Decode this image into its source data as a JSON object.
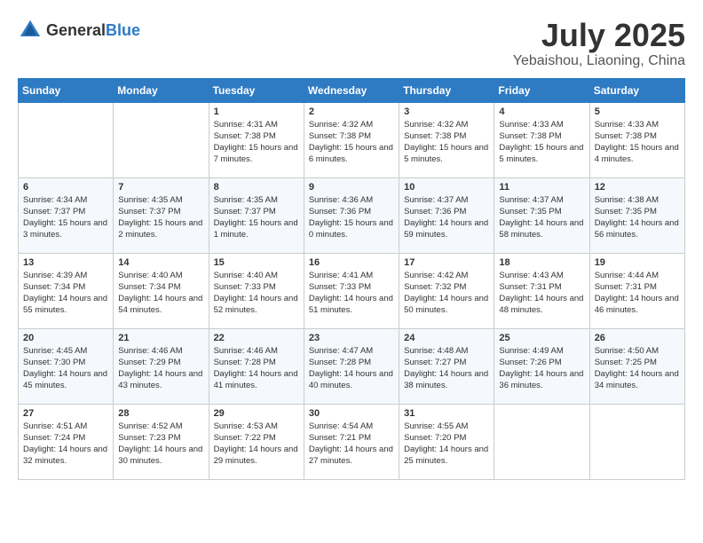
{
  "header": {
    "logo_general": "General",
    "logo_blue": "Blue",
    "month": "July 2025",
    "location": "Yebaishou, Liaoning, China"
  },
  "weekdays": [
    "Sunday",
    "Monday",
    "Tuesday",
    "Wednesday",
    "Thursday",
    "Friday",
    "Saturday"
  ],
  "weeks": [
    [
      {
        "day": "",
        "info": ""
      },
      {
        "day": "",
        "info": ""
      },
      {
        "day": "1",
        "info": "Sunrise: 4:31 AM\nSunset: 7:38 PM\nDaylight: 15 hours and 7 minutes."
      },
      {
        "day": "2",
        "info": "Sunrise: 4:32 AM\nSunset: 7:38 PM\nDaylight: 15 hours and 6 minutes."
      },
      {
        "day": "3",
        "info": "Sunrise: 4:32 AM\nSunset: 7:38 PM\nDaylight: 15 hours and 5 minutes."
      },
      {
        "day": "4",
        "info": "Sunrise: 4:33 AM\nSunset: 7:38 PM\nDaylight: 15 hours and 5 minutes."
      },
      {
        "day": "5",
        "info": "Sunrise: 4:33 AM\nSunset: 7:38 PM\nDaylight: 15 hours and 4 minutes."
      }
    ],
    [
      {
        "day": "6",
        "info": "Sunrise: 4:34 AM\nSunset: 7:37 PM\nDaylight: 15 hours and 3 minutes."
      },
      {
        "day": "7",
        "info": "Sunrise: 4:35 AM\nSunset: 7:37 PM\nDaylight: 15 hours and 2 minutes."
      },
      {
        "day": "8",
        "info": "Sunrise: 4:35 AM\nSunset: 7:37 PM\nDaylight: 15 hours and 1 minute."
      },
      {
        "day": "9",
        "info": "Sunrise: 4:36 AM\nSunset: 7:36 PM\nDaylight: 15 hours and 0 minutes."
      },
      {
        "day": "10",
        "info": "Sunrise: 4:37 AM\nSunset: 7:36 PM\nDaylight: 14 hours and 59 minutes."
      },
      {
        "day": "11",
        "info": "Sunrise: 4:37 AM\nSunset: 7:35 PM\nDaylight: 14 hours and 58 minutes."
      },
      {
        "day": "12",
        "info": "Sunrise: 4:38 AM\nSunset: 7:35 PM\nDaylight: 14 hours and 56 minutes."
      }
    ],
    [
      {
        "day": "13",
        "info": "Sunrise: 4:39 AM\nSunset: 7:34 PM\nDaylight: 14 hours and 55 minutes."
      },
      {
        "day": "14",
        "info": "Sunrise: 4:40 AM\nSunset: 7:34 PM\nDaylight: 14 hours and 54 minutes."
      },
      {
        "day": "15",
        "info": "Sunrise: 4:40 AM\nSunset: 7:33 PM\nDaylight: 14 hours and 52 minutes."
      },
      {
        "day": "16",
        "info": "Sunrise: 4:41 AM\nSunset: 7:33 PM\nDaylight: 14 hours and 51 minutes."
      },
      {
        "day": "17",
        "info": "Sunrise: 4:42 AM\nSunset: 7:32 PM\nDaylight: 14 hours and 50 minutes."
      },
      {
        "day": "18",
        "info": "Sunrise: 4:43 AM\nSunset: 7:31 PM\nDaylight: 14 hours and 48 minutes."
      },
      {
        "day": "19",
        "info": "Sunrise: 4:44 AM\nSunset: 7:31 PM\nDaylight: 14 hours and 46 minutes."
      }
    ],
    [
      {
        "day": "20",
        "info": "Sunrise: 4:45 AM\nSunset: 7:30 PM\nDaylight: 14 hours and 45 minutes."
      },
      {
        "day": "21",
        "info": "Sunrise: 4:46 AM\nSunset: 7:29 PM\nDaylight: 14 hours and 43 minutes."
      },
      {
        "day": "22",
        "info": "Sunrise: 4:46 AM\nSunset: 7:28 PM\nDaylight: 14 hours and 41 minutes."
      },
      {
        "day": "23",
        "info": "Sunrise: 4:47 AM\nSunset: 7:28 PM\nDaylight: 14 hours and 40 minutes."
      },
      {
        "day": "24",
        "info": "Sunrise: 4:48 AM\nSunset: 7:27 PM\nDaylight: 14 hours and 38 minutes."
      },
      {
        "day": "25",
        "info": "Sunrise: 4:49 AM\nSunset: 7:26 PM\nDaylight: 14 hours and 36 minutes."
      },
      {
        "day": "26",
        "info": "Sunrise: 4:50 AM\nSunset: 7:25 PM\nDaylight: 14 hours and 34 minutes."
      }
    ],
    [
      {
        "day": "27",
        "info": "Sunrise: 4:51 AM\nSunset: 7:24 PM\nDaylight: 14 hours and 32 minutes."
      },
      {
        "day": "28",
        "info": "Sunrise: 4:52 AM\nSunset: 7:23 PM\nDaylight: 14 hours and 30 minutes."
      },
      {
        "day": "29",
        "info": "Sunrise: 4:53 AM\nSunset: 7:22 PM\nDaylight: 14 hours and 29 minutes."
      },
      {
        "day": "30",
        "info": "Sunrise: 4:54 AM\nSunset: 7:21 PM\nDaylight: 14 hours and 27 minutes."
      },
      {
        "day": "31",
        "info": "Sunrise: 4:55 AM\nSunset: 7:20 PM\nDaylight: 14 hours and 25 minutes."
      },
      {
        "day": "",
        "info": ""
      },
      {
        "day": "",
        "info": ""
      }
    ]
  ]
}
